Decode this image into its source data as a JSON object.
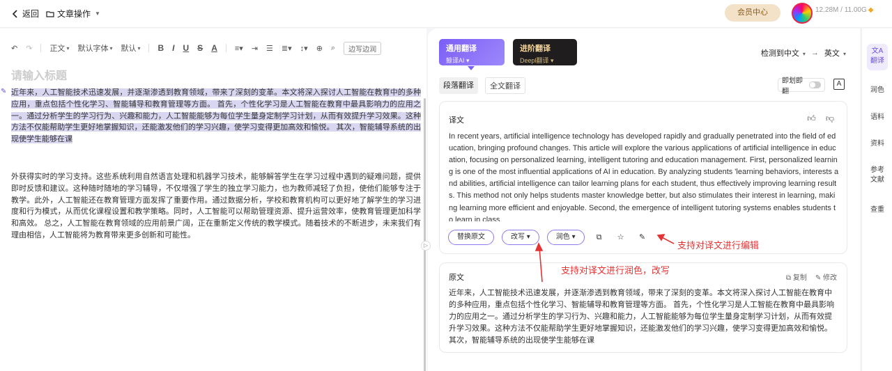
{
  "topbar": {
    "back_label": "返回",
    "doc_menu_label": "文章操作",
    "member_label": "会员中心",
    "storage": "12.28M / 11.00G"
  },
  "editor": {
    "toolbar": {
      "style": "正文",
      "font": "默认字体",
      "size": "默认",
      "margin_label": "边写边润"
    },
    "title_placeholder": "请输入标题",
    "para1": "近年来，人工智能技术迅速发展，并逐渐渗透到教育领域，带来了深刻的变革。本文将深入探讨人工智能在教育中的多种应用，重点包括个性化学习、智能辅导和教育管理等方面。 首先，个性化学习是人工智能在教育中最具影响力的应用之一。通过分析学生的学习行为、兴趣和能力，人工智能能够为每位学生量身定制学习计划，从而有效提升学习效果。这种方法不仅能帮助学生更好地掌握知识，还能激发他们的学习兴趣，使学习变得更加高效和愉悦。 其次，智能辅导系统的出现使学生能够在课",
    "para2": "外获得实时的学习支持。这些系统利用自然语言处理和机器学习技术，能够解答学生在学习过程中遇到的疑难问题，提供即时反馈和建议。这种随时随地的学习辅导，不仅增强了学生的独立学习能力，也为教师减轻了负担，使他们能够专注于教学。此外，人工智能还在教育管理方面发挥了重要作用。通过数据分析，学校和教育机构可以更好地了解学生的学习进度和行为模式，从而优化课程设置和教学策略。同时，人工智能可以帮助管理资源、提升运营效率，使教育管理更加科学和高效。 总之，人工智能在教育领域的应用前景广阔，正在重新定义传统的教学模式。随着技术的不断进步，未来我们有理由相信，人工智能将为教育带来更多创新和可能性。"
  },
  "translate": {
    "mode_general_title": "通用翻译",
    "mode_general_sub": "鲸译AI",
    "mode_adv_title": "进阶翻译",
    "mode_adv_sub": "Deepl翻译",
    "lang_from": "检测到中文",
    "lang_to": "英文",
    "tab_paragraph": "段落翻译",
    "tab_full": "全文翻译",
    "instant_label": "即划即翻",
    "result_heading": "译文",
    "result_text": "In recent years, artificial intelligence technology has developed rapidly and gradually penetrated into the field of education, bringing profound changes. This article will explore the various applications of artificial intelligence in education, focusing on personalized learning, intelligent tutoring and education management. First, personalized learning is one of the most influential applications of AI in education. By analyzing students 'learning behaviors, interests and abilities, artificial intelligence can tailor learning plans for each student, thus effectively improving learning results. This method not only helps students master knowledge better, but also stimulates their interest in learning, making learning more efficient and enjoyable. Second, the emergence of intelligent tutoring systems enables students to learn in class.",
    "btn_replace": "替换原文",
    "btn_rewrite": "改写",
    "btn_polish": "润色",
    "source_heading": "原文",
    "copy_label": "复制",
    "edit_label": "修改",
    "source_text": "近年来，人工智能技术迅速发展，并逐渐渗透到教育领域，带来了深刻的变革。本文将深入探讨人工智能在教育中的多种应用，重点包括个性化学习、智能辅导和教育管理等方面。 首先，个性化学习是人工智能在教育中最具影响力的应用之一。通过分析学生的学习行为、兴趣和能力，人工智能能够为每位学生量身定制学习计划，从而有效提升学习效果。这种方法不仅能帮助学生更好地掌握知识，还能激发他们的学习兴趣，使学习变得更加高效和愉悦。 其次，智能辅导系统的出现使学生能够在课"
  },
  "annotations": {
    "edit": "支持对译文进行编辑",
    "polish": "支持对译文进行润色，改写"
  },
  "rightbar": {
    "translate": "翻译",
    "polish": "润色",
    "corpus": "语料",
    "materials": "资料",
    "references": "参考文献",
    "check": "查重"
  },
  "colors": {
    "accent": "#7b5ef6",
    "annotation_red": "#e53333",
    "member_gold": "#f3e2c8"
  }
}
